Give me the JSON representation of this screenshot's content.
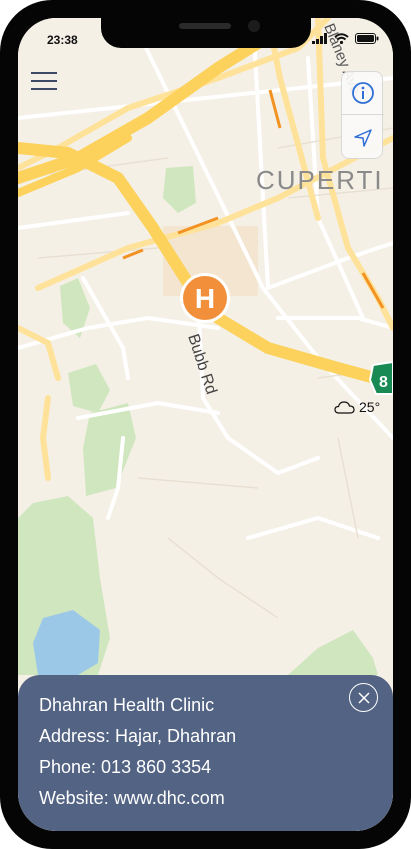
{
  "status_bar": {
    "time": "23:38"
  },
  "map": {
    "city_label": "CUPERTI",
    "street_labels": [
      "Bubb Rd",
      "Blaney Ave"
    ],
    "highway_shield": "8",
    "marker_letter": "H"
  },
  "weather": {
    "temperature": "25°",
    "icon": "cloud-icon"
  },
  "controls": {
    "info": "info-icon",
    "location": "location-arrow-icon",
    "menu": "hamburger-menu-icon"
  },
  "clinic": {
    "name": "Dhahran Health Clinic",
    "address": "Address: Hajar, Dhahran",
    "phone": "Phone: 013 860 3354",
    "website": "Website: www.dhc.com"
  },
  "colors": {
    "panel": "#536383",
    "map_background": "#f5f0e6",
    "highway": "#fcd25c",
    "marker": "#f28f3b",
    "park": "#cfe6bf",
    "water": "#9cc8e8"
  }
}
